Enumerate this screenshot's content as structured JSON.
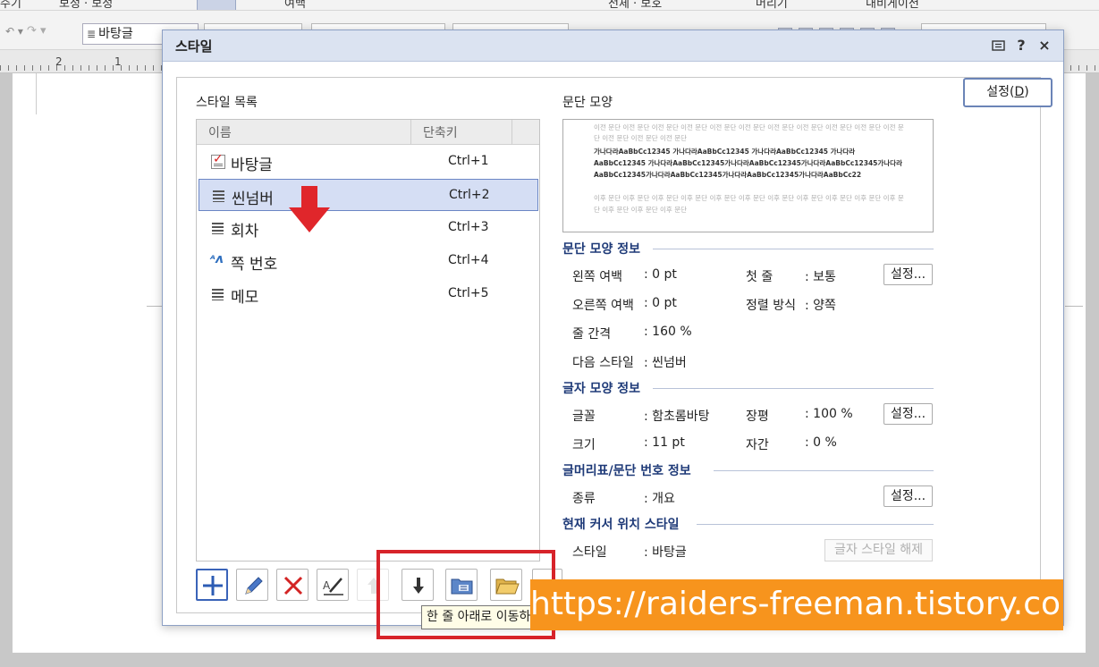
{
  "colors": {
    "dialog_title_bg": "#dbe3f1",
    "selection": "#d5def4",
    "section_title": "#1e3a78",
    "highlight": "#d7232a",
    "watermark_bg": "#f7941d"
  },
  "app": {
    "menu_fragments": [
      "주기",
      "보정 · 보정",
      "여백",
      "전체 · 보호",
      "머리기",
      "내비게이션"
    ],
    "toolbar": {
      "style_value": "바탕글"
    },
    "ruler": {
      "ticks": [
        "2",
        "1"
      ]
    }
  },
  "dialog": {
    "title": "스타일",
    "title_buttons": {
      "menu_icon": "list-icon",
      "help": "?",
      "close": "×"
    },
    "set_button": {
      "label": "설정(",
      "accel": "D",
      "suffix": ")"
    },
    "style_list": {
      "label": "스타일 목록",
      "headers": {
        "name": "이름",
        "shortcut": "단축키"
      },
      "rows": [
        {
          "name": "바탕글",
          "shortcut": "Ctrl+1",
          "icon": "checked-style-icon",
          "selected": false
        },
        {
          "name": "씬넘버",
          "shortcut": "Ctrl+2",
          "icon": "paragraph-style-icon",
          "selected": true
        },
        {
          "name": "회차",
          "shortcut": "Ctrl+3",
          "icon": "paragraph-style-icon",
          "selected": false
        },
        {
          "name": "쪽 번호",
          "shortcut": "Ctrl+4",
          "icon": "char-style-icon",
          "selected": false
        },
        {
          "name": "메모",
          "shortcut": "Ctrl+5",
          "icon": "paragraph-style-icon",
          "selected": false
        }
      ]
    },
    "toolbar_buttons": [
      {
        "name": "add-style-button",
        "icon": "plus-icon"
      },
      {
        "name": "edit-style-button",
        "icon": "pencil-icon"
      },
      {
        "name": "delete-style-button",
        "icon": "x-icon"
      },
      {
        "name": "style-apply-button",
        "icon": "eyedropper-icon"
      },
      {
        "name": "move-up-button",
        "icon": "arrow-up-icon"
      },
      {
        "name": "move-down-button",
        "icon": "arrow-down-icon"
      },
      {
        "name": "import-style-button",
        "icon": "folder-style-icon"
      },
      {
        "name": "open-style-button",
        "icon": "folder-icon"
      }
    ],
    "preview": {
      "label": "문단 모양",
      "prev_text": "이전 문단 이전 문단 이전 문단 이전 문단 이전 문단 이전 문단 이전 문단 이전 문단 이전 문단 이전 문단 이전 문단 이전 문단 이전 문단 이전 문단",
      "sample_text": "가나다라AaBbCc12345 가나다라AaBbCc12345 가나다라AaBbCc12345 가나다라AaBbCc12345 가나다라AaBbCc12345가나다라AaBbCc12345가나다라AaBbCc12345가나다라AaBbCc12345가나다라AaBbCc12345가나다라AaBbCc12345가나다라AaBbCc22",
      "next_text": "이후 문단 이후 문단 이후 문단 이후 문단 이후 문단 이후 문단 이후 문단 이후 문단 이후 문단 이후 문단 이후 문단 이후 문단 이후 문단 이후 문단"
    },
    "para_info": {
      "title": "문단 모양 정보",
      "left_margin_label": "왼쪽 여백",
      "left_margin_value": ": 0 pt",
      "right_margin_label": "오른쪽 여백",
      "right_margin_value": ": 0 pt",
      "line_spacing_label": "줄 간격",
      "line_spacing_value": ": 160 %",
      "next_style_label": "다음 스타일",
      "next_style_value": ": 씬넘버",
      "first_line_label": "첫 줄",
      "first_line_value": ": 보통",
      "align_label": "정렬 방식",
      "align_value": ": 양쪽",
      "button": "설정..."
    },
    "char_info": {
      "title": "글자 모양 정보",
      "font_label": "글꼴",
      "font_value": ": 함초롬바탕",
      "size_label": "크기",
      "size_value": ": 11 pt",
      "ratio_label": "장평",
      "ratio_value": ": 100 %",
      "spacing_label": "자간",
      "spacing_value": ": 0 %",
      "button": "설정..."
    },
    "bullet_info": {
      "title": "글머리표/문단 번호 정보",
      "kind_label": "종류",
      "kind_value": ": 개요",
      "button": "설정..."
    },
    "cursor_info": {
      "title": "현재 커서 위치 스타일",
      "style_label": "스타일",
      "style_value": ": 바탕글",
      "release_button": "글자 스타일 해제"
    }
  },
  "tooltip": "한 줄 아래로 이동하기",
  "watermark": "https://raiders-freeman.tistory.com"
}
